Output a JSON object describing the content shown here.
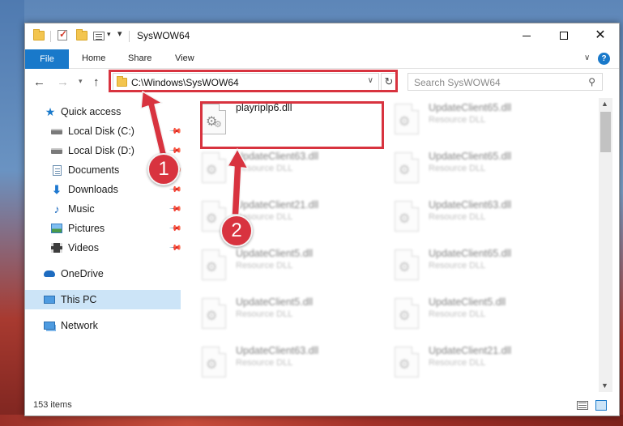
{
  "window": {
    "title": "SysWOW64"
  },
  "ribbon": {
    "tabs": [
      {
        "label": "File",
        "active": true
      },
      {
        "label": "Home"
      },
      {
        "label": "Share"
      },
      {
        "label": "View"
      }
    ],
    "expand_glyph": "∨",
    "help_glyph": "?"
  },
  "address": {
    "path": "C:\\Windows\\SysWOW64",
    "dropdown_glyph": "∨",
    "refresh_glyph": "↻"
  },
  "search": {
    "placeholder": "Search SysWOW64"
  },
  "sidebar": {
    "items": [
      {
        "label": "Quick access",
        "icon": "star-icon"
      },
      {
        "label": "Local Disk (C:)",
        "icon": "drive-icon",
        "pinned": true
      },
      {
        "label": "Local Disk (D:)",
        "icon": "drive-icon",
        "pinned": true
      },
      {
        "label": "Documents",
        "icon": "document-icon",
        "pinned": true
      },
      {
        "label": "Downloads",
        "icon": "download-icon",
        "pinned": true
      },
      {
        "label": "Music",
        "icon": "music-icon",
        "pinned": true
      },
      {
        "label": "Pictures",
        "icon": "pictures-icon",
        "pinned": true
      },
      {
        "label": "Videos",
        "icon": "videos-icon",
        "pinned": true
      },
      {
        "label": "OneDrive",
        "icon": "onedrive-icon"
      },
      {
        "label": "This PC",
        "icon": "this-pc-icon",
        "selected": true
      },
      {
        "label": "Network",
        "icon": "network-icon"
      }
    ]
  },
  "files": [
    {
      "name": "playriplp6.dll",
      "type": ""
    },
    {
      "name": "UpdateClient65.dll",
      "type": "Resource DLL"
    },
    {
      "name": "UpdateClient63.dll",
      "type": "Resource DLL"
    },
    {
      "name": "UpdateClient65.dll",
      "type": "Resource DLL"
    },
    {
      "name": "UpdateClient21.dll",
      "type": "Resource DLL"
    },
    {
      "name": "UpdateClient63.dll",
      "type": "Resource DLL"
    },
    {
      "name": "UpdateClient5.dll",
      "type": "Resource DLL"
    },
    {
      "name": "UpdateClient65.dll",
      "type": "Resource DLL"
    },
    {
      "name": "UpdateClient5.dll",
      "type": "Resource DLL"
    },
    {
      "name": "UpdateClient5.dll",
      "type": "Resource DLL"
    },
    {
      "name": "UpdateClient63.dll",
      "type": "Resource DLL"
    },
    {
      "name": "UpdateClient21.dll",
      "type": "Resource DLL"
    }
  ],
  "status": {
    "item_count": "153 items"
  },
  "annotations": [
    {
      "label": "1"
    },
    {
      "label": "2"
    }
  ],
  "colors": {
    "accent": "#1979ca",
    "highlight": "#d8333f",
    "selection": "#cce4f7"
  }
}
